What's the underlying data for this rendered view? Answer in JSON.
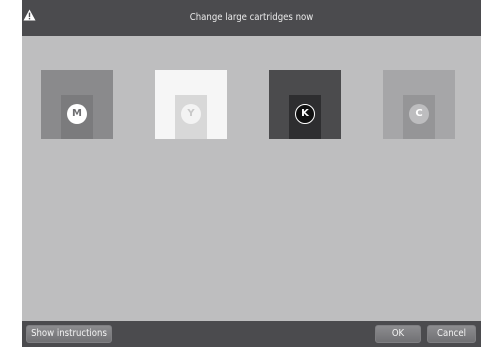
{
  "title_bar": {
    "icon": "warning-icon",
    "title": "Change large cartridges now"
  },
  "cartridges": [
    {
      "label": "M",
      "color": "#8a8a8c"
    },
    {
      "label": "Y",
      "color": "#f6f6f6"
    },
    {
      "label": "K",
      "color": "#4b4b4d"
    },
    {
      "label": "C",
      "color": "#a6a6a8"
    }
  ],
  "buttons": {
    "show_instructions": "Show instructions",
    "ok": "OK",
    "cancel": "Cancel"
  },
  "colors": {
    "bar": "#4b4b4e",
    "panel": "#bebebf"
  }
}
